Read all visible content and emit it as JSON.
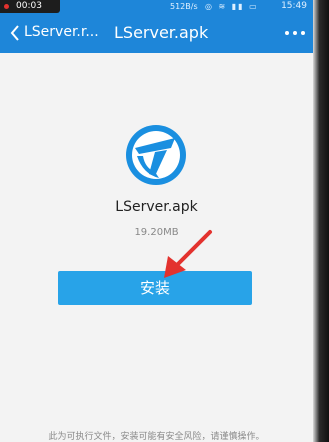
{
  "status_bar": {
    "recording_time": "00:03",
    "net_speed": "512B/s",
    "clock": "15:49"
  },
  "header": {
    "back_label": "LServer.r...",
    "title": "LServer.apk"
  },
  "app": {
    "name": "LServer.apk",
    "size": "19.20MB"
  },
  "install_button": {
    "label": "安装"
  },
  "warning_text": "此为可执行文件，安装可能有安全风险，请谨慎操作。",
  "colors": {
    "header_bg": "#1e86d9",
    "install_bg": "#28a3e8",
    "arrow": "#e3322e",
    "icon_blue": "#1a8fe0"
  }
}
